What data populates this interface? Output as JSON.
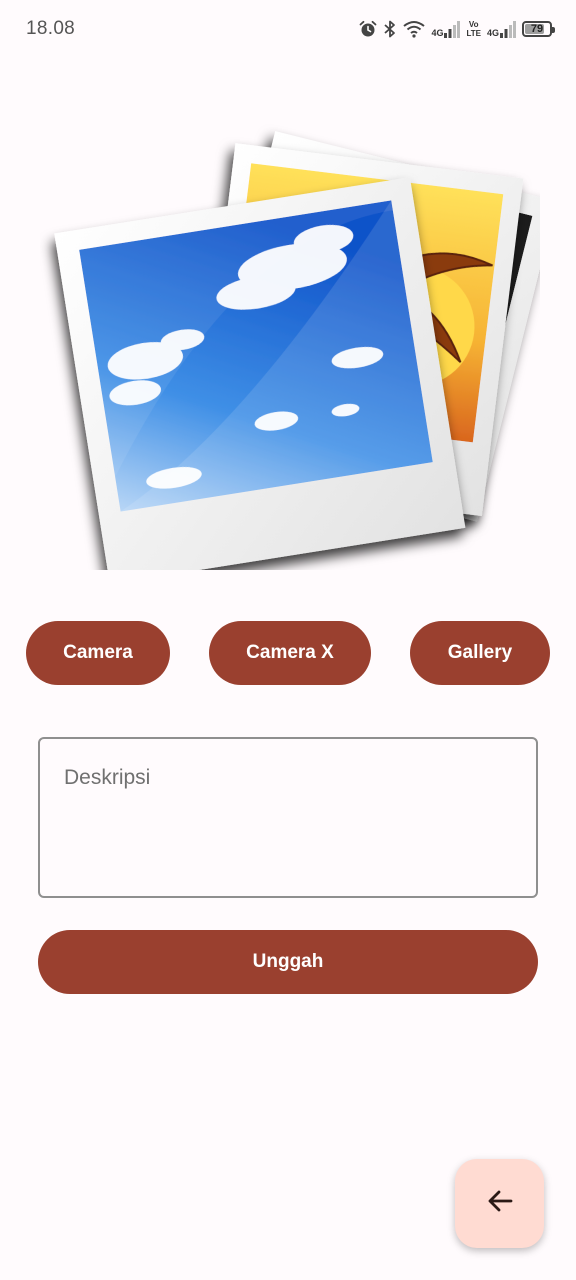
{
  "status_bar": {
    "time": "18.08",
    "network_1": "4G",
    "volte": "Vo\nLTE",
    "network_2": "4G",
    "battery": "79",
    "battery_level": 0.79,
    "icons": [
      "alarm-icon",
      "bluetooth-icon",
      "wifi-icon",
      "signal-icon",
      "signal-icon",
      "battery-icon"
    ]
  },
  "preview": {
    "icon": "photo-stack-placeholder-image"
  },
  "actions": {
    "camera_label": "Camera",
    "camera_x_label": "Camera X",
    "gallery_label": "Gallery"
  },
  "description": {
    "placeholder": "Deskripsi",
    "value": ""
  },
  "upload": {
    "label": "Unggah"
  },
  "fab": {
    "icon": "arrow-back-icon"
  },
  "colors": {
    "primary": "#9a402f",
    "fab_background": "#ffdbd2",
    "background": "#fffbfd"
  }
}
